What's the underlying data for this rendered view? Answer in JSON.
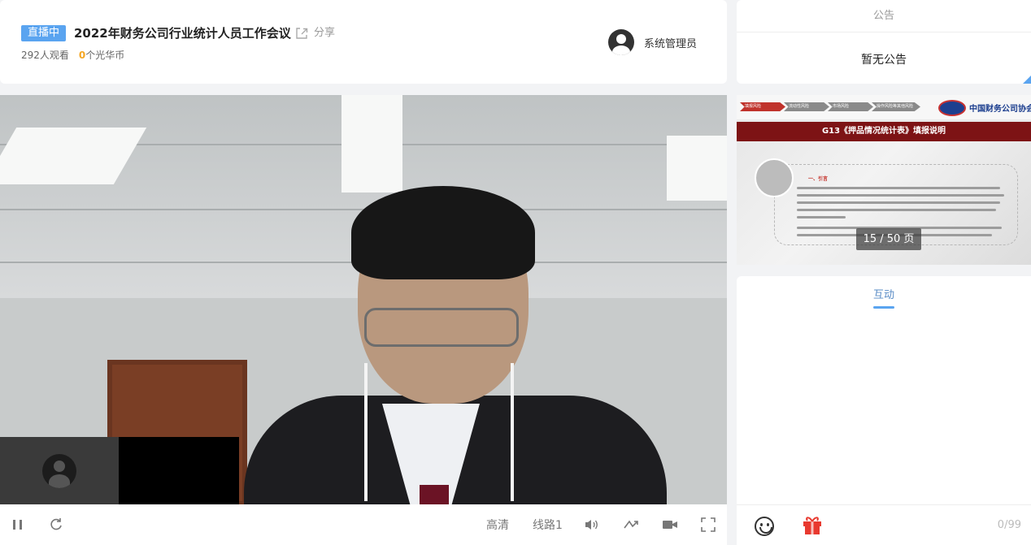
{
  "header": {
    "status_badge": "直播中",
    "title": "2022年财务公司行业统计人员工作会议",
    "share_label": "分享",
    "viewers": "292人观看",
    "coin_count": "0",
    "coin_label": "个光华币",
    "user_name": "系统管理员"
  },
  "player": {
    "quality": "高清",
    "line": "线路1"
  },
  "notice": {
    "title": "公告",
    "body": "暂无公告"
  },
  "slide": {
    "steps": [
      "填报风险",
      "流动性风险",
      "市场风险",
      "操作风险等其他风险"
    ],
    "org_name": "中国财务公司协会",
    "title": "G13《押品情况统计表》填报说明",
    "section_heading": "一、引言",
    "page_indicator": "15 / 50 页"
  },
  "interaction": {
    "tab_label": "互动",
    "char_counter": "0/99"
  },
  "colors": {
    "accent": "#5aa4f0",
    "coin": "#f5a623",
    "slide_banner": "#7d1315",
    "gift": "#e8392f"
  },
  "icons": [
    "share-icon",
    "pause-icon",
    "refresh-icon",
    "volume-icon",
    "rotate-icon",
    "camera-icon",
    "fullscreen-icon",
    "emoji-icon",
    "gift-icon",
    "user-avatar-icon"
  ]
}
